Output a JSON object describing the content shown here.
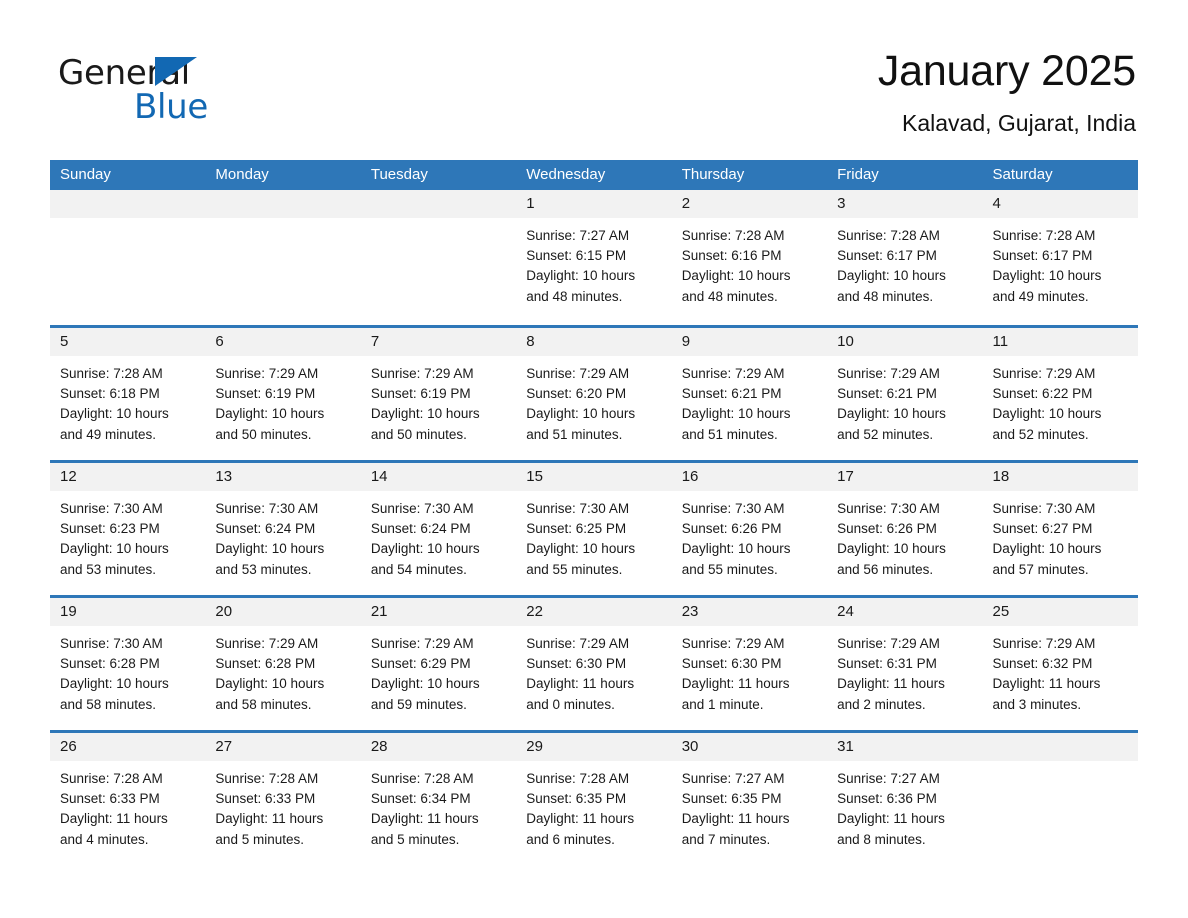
{
  "brand": {
    "name_part1": "General",
    "name_part2": "Blue",
    "triangle_color": "#1268b3",
    "blue_color": "#1268b3"
  },
  "header": {
    "month_title": "January 2025",
    "location": "Kalavad, Gujarat, India"
  },
  "calendar": {
    "header_bg": "#2e77b8",
    "row_divider_color": "#2e77b8",
    "numband_bg": "#f2f2f2",
    "weekdays": [
      "Sunday",
      "Monday",
      "Tuesday",
      "Wednesday",
      "Thursday",
      "Friday",
      "Saturday"
    ],
    "weeks": [
      [
        {
          "day": "",
          "lines": []
        },
        {
          "day": "",
          "lines": []
        },
        {
          "day": "",
          "lines": []
        },
        {
          "day": "1",
          "lines": [
            "Sunrise: 7:27 AM",
            "Sunset: 6:15 PM",
            "Daylight: 10 hours",
            "and 48 minutes."
          ]
        },
        {
          "day": "2",
          "lines": [
            "Sunrise: 7:28 AM",
            "Sunset: 6:16 PM",
            "Daylight: 10 hours",
            "and 48 minutes."
          ]
        },
        {
          "day": "3",
          "lines": [
            "Sunrise: 7:28 AM",
            "Sunset: 6:17 PM",
            "Daylight: 10 hours",
            "and 48 minutes."
          ]
        },
        {
          "day": "4",
          "lines": [
            "Sunrise: 7:28 AM",
            "Sunset: 6:17 PM",
            "Daylight: 10 hours",
            "and 49 minutes."
          ]
        }
      ],
      [
        {
          "day": "5",
          "lines": [
            "Sunrise: 7:28 AM",
            "Sunset: 6:18 PM",
            "Daylight: 10 hours",
            "and 49 minutes."
          ]
        },
        {
          "day": "6",
          "lines": [
            "Sunrise: 7:29 AM",
            "Sunset: 6:19 PM",
            "Daylight: 10 hours",
            "and 50 minutes."
          ]
        },
        {
          "day": "7",
          "lines": [
            "Sunrise: 7:29 AM",
            "Sunset: 6:19 PM",
            "Daylight: 10 hours",
            "and 50 minutes."
          ]
        },
        {
          "day": "8",
          "lines": [
            "Sunrise: 7:29 AM",
            "Sunset: 6:20 PM",
            "Daylight: 10 hours",
            "and 51 minutes."
          ]
        },
        {
          "day": "9",
          "lines": [
            "Sunrise: 7:29 AM",
            "Sunset: 6:21 PM",
            "Daylight: 10 hours",
            "and 51 minutes."
          ]
        },
        {
          "day": "10",
          "lines": [
            "Sunrise: 7:29 AM",
            "Sunset: 6:21 PM",
            "Daylight: 10 hours",
            "and 52 minutes."
          ]
        },
        {
          "day": "11",
          "lines": [
            "Sunrise: 7:29 AM",
            "Sunset: 6:22 PM",
            "Daylight: 10 hours",
            "and 52 minutes."
          ]
        }
      ],
      [
        {
          "day": "12",
          "lines": [
            "Sunrise: 7:30 AM",
            "Sunset: 6:23 PM",
            "Daylight: 10 hours",
            "and 53 minutes."
          ]
        },
        {
          "day": "13",
          "lines": [
            "Sunrise: 7:30 AM",
            "Sunset: 6:24 PM",
            "Daylight: 10 hours",
            "and 53 minutes."
          ]
        },
        {
          "day": "14",
          "lines": [
            "Sunrise: 7:30 AM",
            "Sunset: 6:24 PM",
            "Daylight: 10 hours",
            "and 54 minutes."
          ]
        },
        {
          "day": "15",
          "lines": [
            "Sunrise: 7:30 AM",
            "Sunset: 6:25 PM",
            "Daylight: 10 hours",
            "and 55 minutes."
          ]
        },
        {
          "day": "16",
          "lines": [
            "Sunrise: 7:30 AM",
            "Sunset: 6:26 PM",
            "Daylight: 10 hours",
            "and 55 minutes."
          ]
        },
        {
          "day": "17",
          "lines": [
            "Sunrise: 7:30 AM",
            "Sunset: 6:26 PM",
            "Daylight: 10 hours",
            "and 56 minutes."
          ]
        },
        {
          "day": "18",
          "lines": [
            "Sunrise: 7:30 AM",
            "Sunset: 6:27 PM",
            "Daylight: 10 hours",
            "and 57 minutes."
          ]
        }
      ],
      [
        {
          "day": "19",
          "lines": [
            "Sunrise: 7:30 AM",
            "Sunset: 6:28 PM",
            "Daylight: 10 hours",
            "and 58 minutes."
          ]
        },
        {
          "day": "20",
          "lines": [
            "Sunrise: 7:29 AM",
            "Sunset: 6:28 PM",
            "Daylight: 10 hours",
            "and 58 minutes."
          ]
        },
        {
          "day": "21",
          "lines": [
            "Sunrise: 7:29 AM",
            "Sunset: 6:29 PM",
            "Daylight: 10 hours",
            "and 59 minutes."
          ]
        },
        {
          "day": "22",
          "lines": [
            "Sunrise: 7:29 AM",
            "Sunset: 6:30 PM",
            "Daylight: 11 hours",
            "and 0 minutes."
          ]
        },
        {
          "day": "23",
          "lines": [
            "Sunrise: 7:29 AM",
            "Sunset: 6:30 PM",
            "Daylight: 11 hours",
            "and 1 minute."
          ]
        },
        {
          "day": "24",
          "lines": [
            "Sunrise: 7:29 AM",
            "Sunset: 6:31 PM",
            "Daylight: 11 hours",
            "and 2 minutes."
          ]
        },
        {
          "day": "25",
          "lines": [
            "Sunrise: 7:29 AM",
            "Sunset: 6:32 PM",
            "Daylight: 11 hours",
            "and 3 minutes."
          ]
        }
      ],
      [
        {
          "day": "26",
          "lines": [
            "Sunrise: 7:28 AM",
            "Sunset: 6:33 PM",
            "Daylight: 11 hours",
            "and 4 minutes."
          ]
        },
        {
          "day": "27",
          "lines": [
            "Sunrise: 7:28 AM",
            "Sunset: 6:33 PM",
            "Daylight: 11 hours",
            "and 5 minutes."
          ]
        },
        {
          "day": "28",
          "lines": [
            "Sunrise: 7:28 AM",
            "Sunset: 6:34 PM",
            "Daylight: 11 hours",
            "and 5 minutes."
          ]
        },
        {
          "day": "29",
          "lines": [
            "Sunrise: 7:28 AM",
            "Sunset: 6:35 PM",
            "Daylight: 11 hours",
            "and 6 minutes."
          ]
        },
        {
          "day": "30",
          "lines": [
            "Sunrise: 7:27 AM",
            "Sunset: 6:35 PM",
            "Daylight: 11 hours",
            "and 7 minutes."
          ]
        },
        {
          "day": "31",
          "lines": [
            "Sunrise: 7:27 AM",
            "Sunset: 6:36 PM",
            "Daylight: 11 hours",
            "and 8 minutes."
          ]
        },
        {
          "day": "",
          "lines": []
        }
      ]
    ]
  }
}
